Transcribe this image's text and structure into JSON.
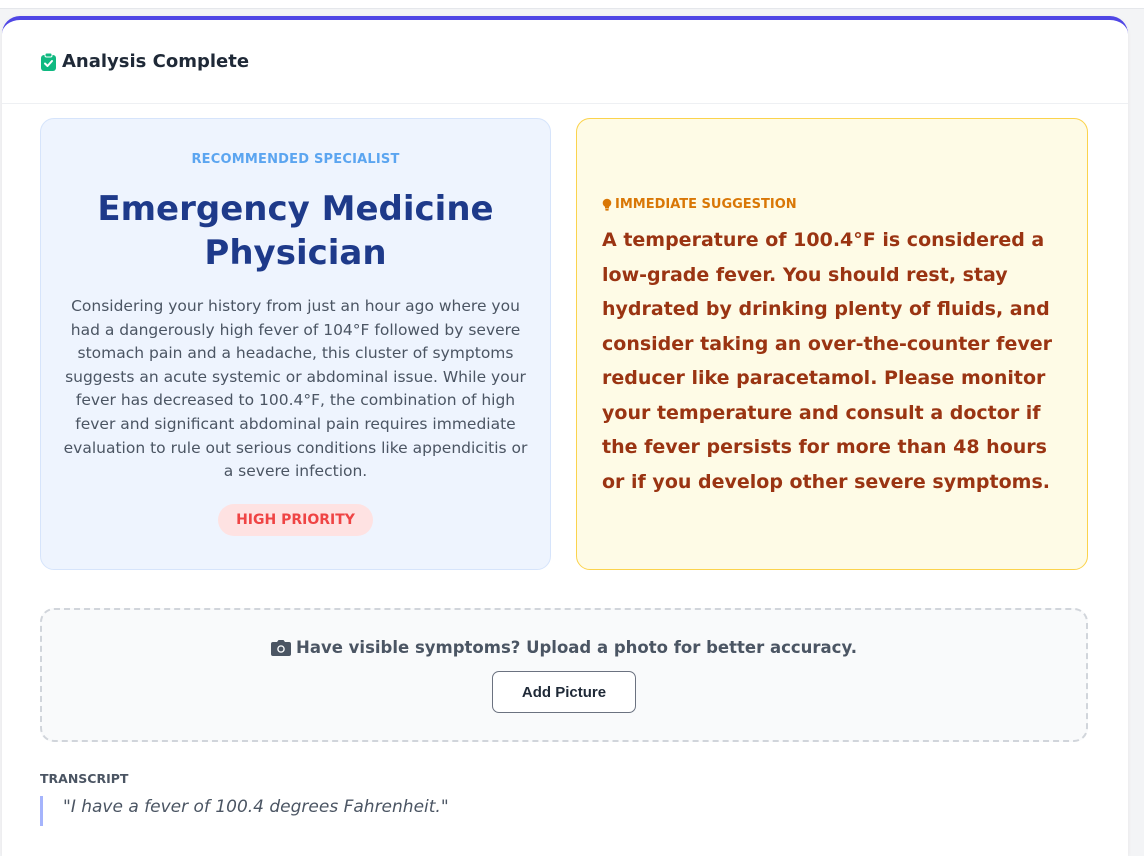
{
  "header": {
    "title": "Analysis Complete",
    "icon": "clipboard-check-icon",
    "accent_color": "#4f46e5",
    "icon_color": "#10b981"
  },
  "specialist": {
    "label": "RECOMMENDED SPECIALIST",
    "title": "Emergency Medicine Physician",
    "description": "Considering your history from just an hour ago where you had a dangerously high fever of 104°F followed by severe stomach pain and a headache, this cluster of symptoms suggests an acute systemic or abdominal issue. While your fever has decreased to 100.4°F, the combination of high fever and significant abdominal pain requires immediate evaluation to rule out serious conditions like appendicitis or a severe infection.",
    "priority": "HIGH PRIORITY"
  },
  "suggestion": {
    "label": "IMMEDIATE SUGGESTION",
    "icon": "lightbulb-icon",
    "text": "A temperature of 100.4°F is considered a low-grade fever. You should rest, stay hydrated by drinking plenty of fluids, and consider taking an over-the-counter fever reducer like paracetamol. Please monitor your temperature and consult a doctor if the fever persists for more than 48 hours or if you develop other severe symptoms."
  },
  "upload": {
    "icon": "camera-icon",
    "prompt": "Have visible symptoms? Upload a photo for better accuracy.",
    "button_label": "Add Picture"
  },
  "transcript": {
    "label": "TRANSCRIPT",
    "quote": "\"I have a fever of 100.4 degrees Fahrenheit.\""
  }
}
